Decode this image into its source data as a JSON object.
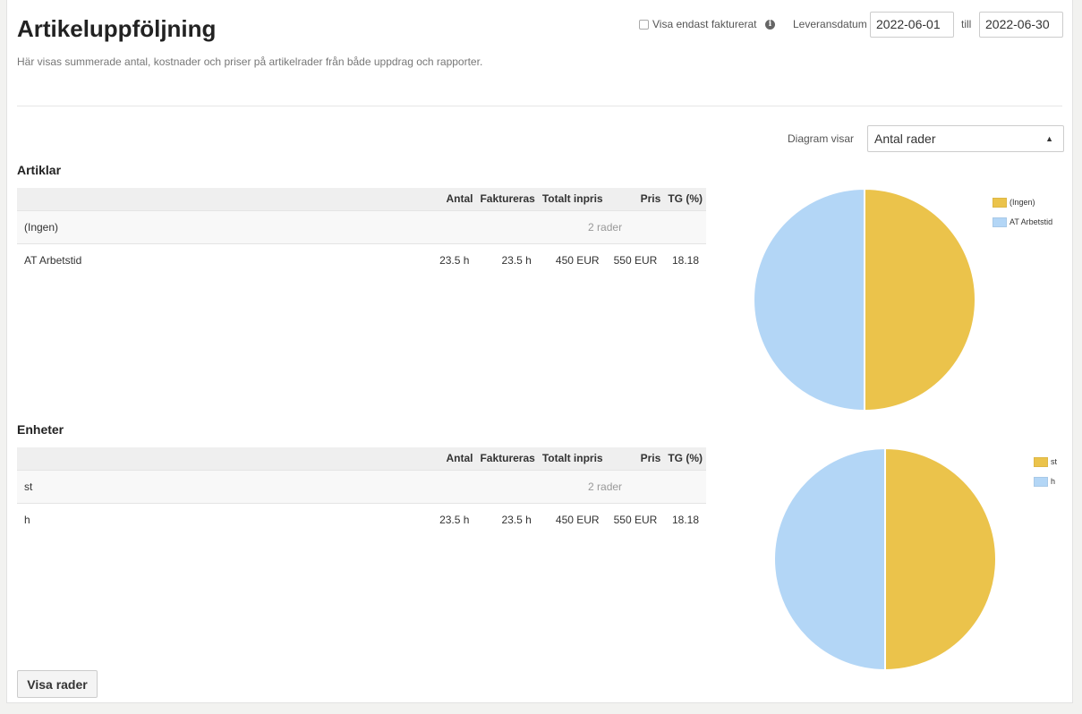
{
  "header": {
    "title": "Artikeluppföljning",
    "subtitle": "Här visas summerade antal, kostnader och priser på artikelrader från både uppdrag och rapporter."
  },
  "filters": {
    "only_invoiced_label": "Visa endast fakturerat",
    "delivery_date_label": "Leveransdatum",
    "date_from": "2022-06-01",
    "till_label": "till",
    "date_to": "2022-06-30"
  },
  "diagram": {
    "label": "Diagram visar",
    "selected": "Antal rader"
  },
  "columns": [
    "Antal",
    "Faktureras",
    "Totalt inpris",
    "Pris",
    "TG (%)"
  ],
  "articles": {
    "title": "Artiklar",
    "rows": [
      {
        "name": "(Ingen)",
        "summary": "2 rader"
      },
      {
        "name": "AT Arbetstid",
        "antal": "23.5 h",
        "faktureras": "23.5 h",
        "inpris": "450 EUR",
        "pris": "550 EUR",
        "tg": "18.18"
      }
    ]
  },
  "units": {
    "title": "Enheter",
    "rows": [
      {
        "name": "st",
        "summary": "2 rader"
      },
      {
        "name": "h",
        "antal": "23.5 h",
        "faktureras": "23.5 h",
        "inpris": "450 EUR",
        "pris": "550 EUR",
        "tg": "18.18"
      }
    ]
  },
  "chart_data": [
    {
      "type": "pie",
      "categories": [
        "(Ingen)",
        "AT Arbetstid"
      ],
      "values": [
        1,
        1
      ],
      "colors": [
        "#ebc34b",
        "#b3d6f6"
      ],
      "legend": "top-right"
    },
    {
      "type": "pie",
      "categories": [
        "st",
        "h"
      ],
      "values": [
        1,
        1
      ],
      "colors": [
        "#ebc34b",
        "#b3d6f6"
      ],
      "legend": "top-right"
    }
  ],
  "actions": {
    "show_rows_label": "Visa rader"
  }
}
